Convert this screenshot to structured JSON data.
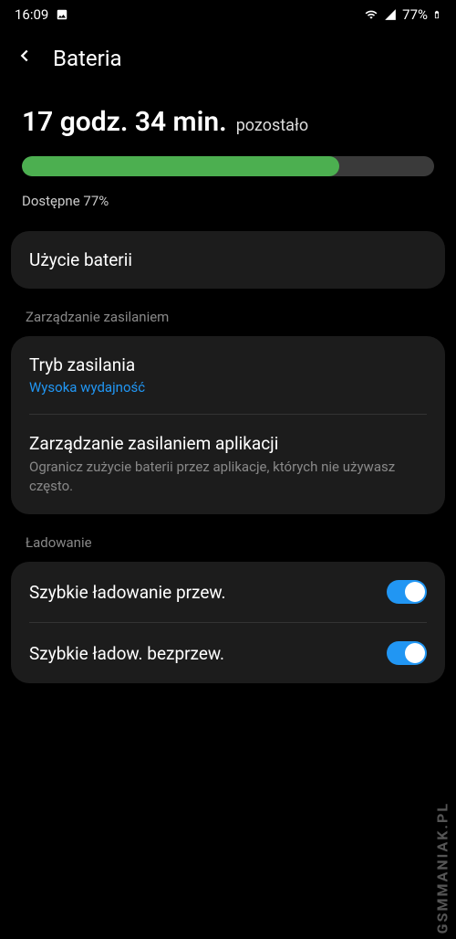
{
  "status_bar": {
    "time": "16:09",
    "battery_percent": "77%"
  },
  "header": {
    "title": "Bateria"
  },
  "battery": {
    "time_remaining": "17 godz. 34 min.",
    "time_suffix": "pozostało",
    "progress_percent": 77,
    "available_label": "Dostępne 77%"
  },
  "usage_card": {
    "title": "Użycie baterii"
  },
  "power_section": {
    "header": "Zarządzanie zasilaniem",
    "mode": {
      "title": "Tryb zasilania",
      "value": "Wysoka wydajność"
    },
    "app_management": {
      "title": "Zarządzanie zasilaniem aplikacji",
      "description": "Ogranicz zużycie baterii przez aplikacje, których nie używasz często."
    }
  },
  "charging_section": {
    "header": "Ładowanie",
    "fast_wired": {
      "label": "Szybkie ładowanie przew.",
      "enabled": true
    },
    "fast_wireless": {
      "label": "Szybkie ładow. bezprzew.",
      "enabled": true
    }
  },
  "watermark": "GSMMANIAK.PL"
}
